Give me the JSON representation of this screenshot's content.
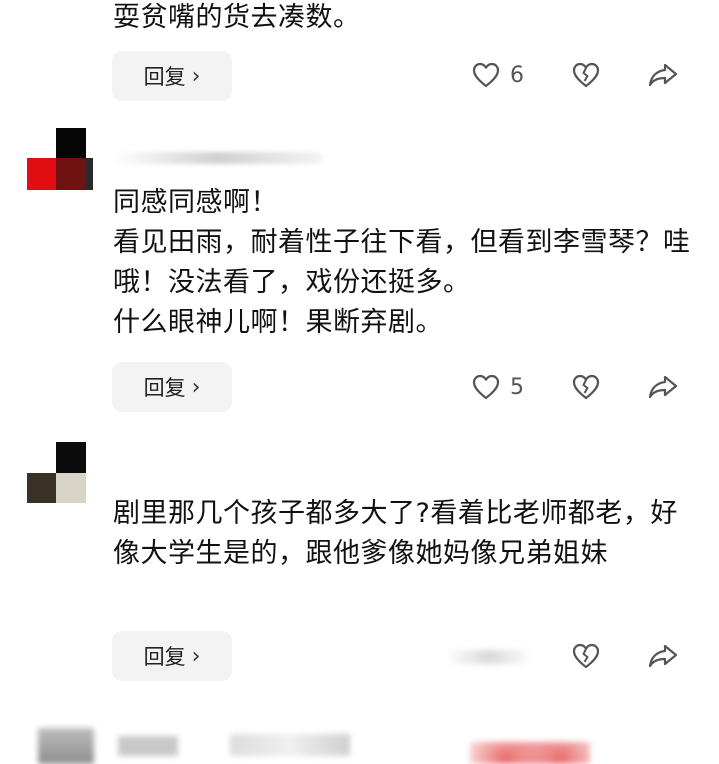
{
  "comments": [
    {
      "text": "耍贫嘴的货去凑数。",
      "reply_label": "回复",
      "likes": "6"
    },
    {
      "text": "同感同感啊！\n看见田雨，耐着性子往下看，但看到李雪琴？哇哦！没法看了，戏份还挺多。\n什么眼神儿啊！果断弃剧。",
      "reply_label": "回复",
      "likes": "5"
    },
    {
      "text": "剧里那几个孩子都多大了?看着比老师都老，好像大学生是的，跟他爹像她妈像兄弟姐妹",
      "reply_label": "回复"
    }
  ],
  "icons": {
    "like": "heart-outline-icon",
    "dislike": "broken-heart-icon",
    "share": "share-arrow-icon",
    "reply_chevron": "chevron-right-icon"
  },
  "colors": {
    "reply_bg": "#f3f3f3",
    "icon_stroke": "#555555",
    "text": "#111111"
  }
}
